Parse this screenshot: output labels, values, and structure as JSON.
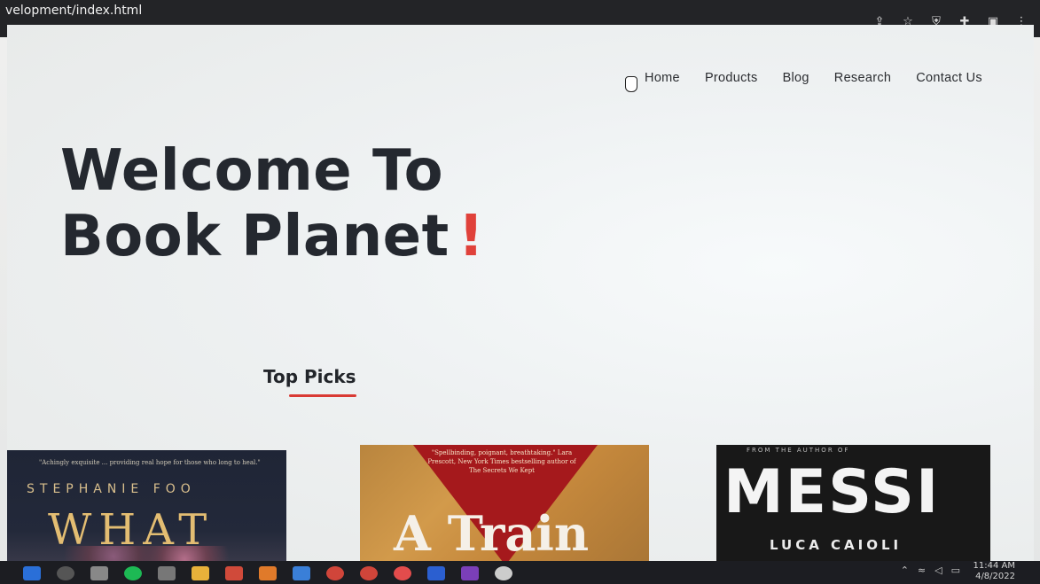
{
  "browser": {
    "url_fragment": "velopment/index.html",
    "toolbar_icons": [
      "share-icon",
      "star-icon",
      "shield-icon",
      "puzzle-icon",
      "sidebar-icon",
      "kebab-menu-icon"
    ]
  },
  "nav": {
    "items": [
      {
        "label": "Home"
      },
      {
        "label": "Products"
      },
      {
        "label": "Blog"
      },
      {
        "label": "Research"
      },
      {
        "label": "Contact Us"
      }
    ]
  },
  "hero": {
    "line1": "Welcome To",
    "line2": "Book Planet",
    "exclamation": "!",
    "accent_color": "#e0413a"
  },
  "section": {
    "title": "Top Picks",
    "underline_color": "#d93a34"
  },
  "books": [
    {
      "quote": "\"Achingly exquisite ... providing real hope for those who long to heal.\"",
      "author": "STEPHANIE FOO",
      "title": "WHAT"
    },
    {
      "quote": "\"Spellbinding, poignant, breathtaking.\" Lara Prescott, New York Times bestselling author of The Secrets We Kept",
      "title": "A Train"
    },
    {
      "tagline": "FROM THE AUTHOR OF",
      "title": "MESSI",
      "author": "LUCA CAIOLI"
    }
  ],
  "taskbar": {
    "time": "11:44 AM",
    "date": "4/8/2022"
  }
}
